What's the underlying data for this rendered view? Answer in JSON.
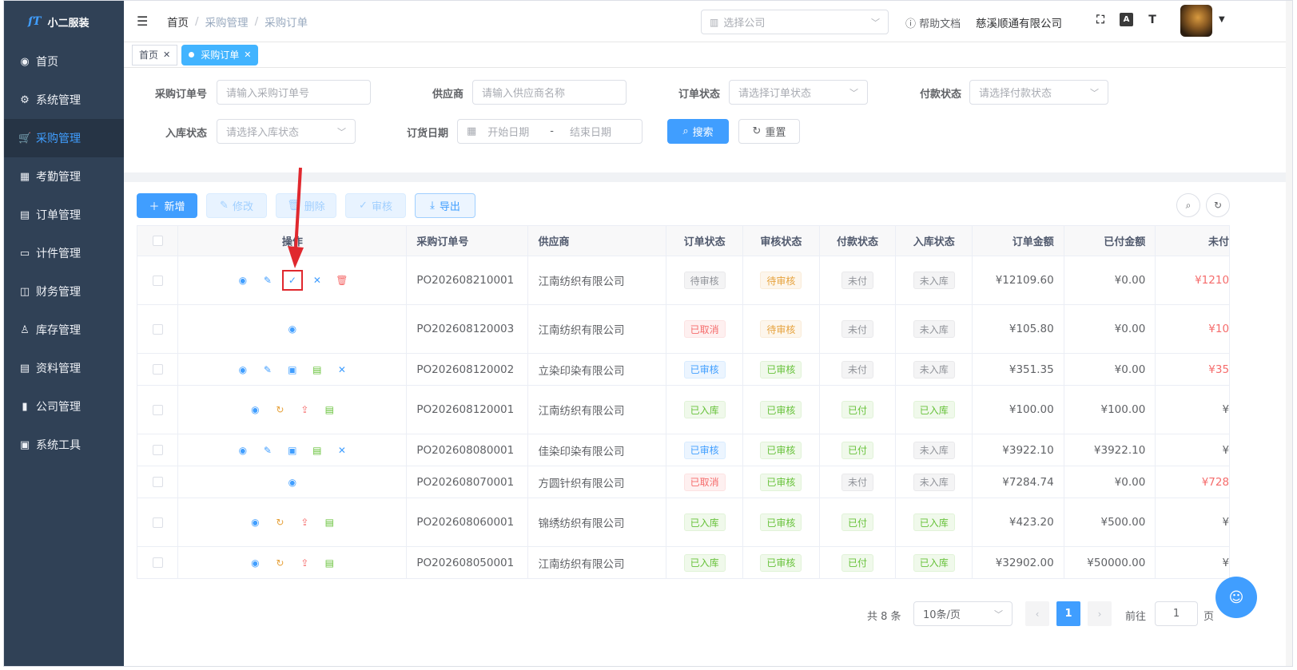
{
  "sidebar": {
    "logo_mark": "ſƬ",
    "logo_text": "小二服装",
    "items": [
      {
        "label": "首页",
        "icon": "dashboard-icon",
        "glyph": "◉"
      },
      {
        "label": "系统管理",
        "icon": "gear-icon",
        "glyph": "⚙"
      },
      {
        "label": "采购管理",
        "icon": "cart-icon",
        "glyph": "🛒"
      },
      {
        "label": "考勤管理",
        "icon": "grid-icon",
        "glyph": "▦"
      },
      {
        "label": "订单管理",
        "icon": "order-icon",
        "glyph": "▤"
      },
      {
        "label": "计件管理",
        "icon": "book-icon",
        "glyph": "▭"
      },
      {
        "label": "财务管理",
        "icon": "chart-monitor-icon",
        "glyph": "◫"
      },
      {
        "label": "库存管理",
        "icon": "user-icon",
        "glyph": "♙"
      },
      {
        "label": "资料管理",
        "icon": "document-icon",
        "glyph": "▤"
      },
      {
        "label": "公司管理",
        "icon": "bar-chart-icon",
        "glyph": "▮"
      },
      {
        "label": "系统工具",
        "icon": "toolbox-icon",
        "glyph": "▣"
      }
    ]
  },
  "header": {
    "breadcrumb": [
      "首页",
      "采购管理",
      "采购订单"
    ],
    "company_placeholder": "选择公司",
    "help": "帮助文档",
    "company_name": "慈溪顺通有限公司"
  },
  "tags": [
    {
      "label": "首页"
    },
    {
      "label": "采购订单"
    }
  ],
  "search": {
    "po_label": "采购订单号",
    "po_placeholder": "请输入采购订单号",
    "supplier_label": "供应商",
    "supplier_placeholder": "请输入供应商名称",
    "order_status_label": "订单状态",
    "order_status_placeholder": "请选择订单状态",
    "pay_status_label": "付款状态",
    "pay_status_placeholder": "请选择付款状态",
    "stock_status_label": "入库状态",
    "stock_status_placeholder": "请选择入库状态",
    "date_label": "订货日期",
    "date_start": "开始日期",
    "date_sep": "-",
    "date_end": "结束日期",
    "search_btn": "搜索",
    "reset_btn": "重置"
  },
  "toolbar": {
    "add": "新增",
    "edit": "修改",
    "delete": "删除",
    "audit": "审核",
    "export": "导出"
  },
  "table": {
    "headers": [
      "操作",
      "采购订单号",
      "供应商",
      "订单状态",
      "审核状态",
      "付款状态",
      "入库状态",
      "订单金额",
      "已付金额",
      "未付"
    ],
    "rows": [
      {
        "h": 61,
        "ops": [
          [
            "eye-icon",
            "◉",
            "blue"
          ],
          [
            "edit-icon",
            "✎",
            "blue"
          ],
          [
            "check-icon",
            "✓",
            "blue"
          ],
          [
            "close-icon",
            "✕",
            "blue"
          ],
          [
            "delete-icon",
            "🗑",
            "red"
          ]
        ],
        "highlight": 2,
        "po": "PO202608210001",
        "supplier": "江南纺织有限公司",
        "order": [
          "待审核",
          "gray"
        ],
        "audit": [
          "待审核",
          "orange"
        ],
        "pay": [
          "未付",
          "gray"
        ],
        "stock": [
          "未入库",
          "gray"
        ],
        "amount": "¥12109.60",
        "paid": "¥0.00",
        "unpaid": "¥1210",
        "unpaid_red": true
      },
      {
        "h": 61,
        "ops": [
          [
            "eye-icon",
            "◉",
            "blue"
          ]
        ],
        "po": "PO202608120003",
        "supplier": "江南纺织有限公司",
        "order": [
          "已取消",
          "red"
        ],
        "audit": [
          "待审核",
          "orange"
        ],
        "pay": [
          "未付",
          "gray"
        ],
        "stock": [
          "未入库",
          "gray"
        ],
        "amount": "¥105.80",
        "paid": "¥0.00",
        "unpaid": "¥10",
        "unpaid_red": true
      },
      {
        "h": 40,
        "ops": [
          [
            "eye-icon",
            "◉",
            "blue"
          ],
          [
            "edit-icon",
            "✎",
            "blue"
          ],
          [
            "stock-in-icon",
            "▣",
            "blue"
          ],
          [
            "payment-icon",
            "▤",
            "green"
          ],
          [
            "close-icon",
            "✕",
            "blue"
          ]
        ],
        "po": "PO202608120002",
        "supplier": "立染印染有限公司",
        "order": [
          "已审核",
          "blue"
        ],
        "audit": [
          "已审核",
          "green"
        ],
        "pay": [
          "未付",
          "gray"
        ],
        "stock": [
          "未入库",
          "gray"
        ],
        "amount": "¥351.35",
        "paid": "¥0.00",
        "unpaid": "¥35",
        "unpaid_red": true
      },
      {
        "h": 61,
        "ops": [
          [
            "eye-icon",
            "◉",
            "blue"
          ],
          [
            "refresh-icon",
            "↻",
            "orange"
          ],
          [
            "return-icon",
            "⇪",
            "red"
          ],
          [
            "payment-icon",
            "▤",
            "green"
          ]
        ],
        "po": "PO202608120001",
        "supplier": "江南纺织有限公司",
        "order": [
          "已入库",
          "green"
        ],
        "audit": [
          "已审核",
          "green"
        ],
        "pay": [
          "已付",
          "green"
        ],
        "stock": [
          "已入库",
          "green"
        ],
        "amount": "¥100.00",
        "paid": "¥100.00",
        "unpaid": "¥",
        "unpaid_red": false
      },
      {
        "h": 40,
        "ops": [
          [
            "eye-icon",
            "◉",
            "blue"
          ],
          [
            "edit-icon",
            "✎",
            "blue"
          ],
          [
            "stock-in-icon",
            "▣",
            "blue"
          ],
          [
            "payment-icon",
            "▤",
            "green"
          ],
          [
            "close-icon",
            "✕",
            "blue"
          ]
        ],
        "po": "PO202608080001",
        "supplier": "佳染印染有限公司",
        "order": [
          "已审核",
          "blue"
        ],
        "audit": [
          "已审核",
          "green"
        ],
        "pay": [
          "已付",
          "green"
        ],
        "stock": [
          "未入库",
          "gray"
        ],
        "amount": "¥3922.10",
        "paid": "¥3922.10",
        "unpaid": "¥",
        "unpaid_red": false
      },
      {
        "h": 40,
        "ops": [
          [
            "eye-icon",
            "◉",
            "blue"
          ]
        ],
        "po": "PO202608070001",
        "supplier": "方圆针织有限公司",
        "order": [
          "已取消",
          "red"
        ],
        "audit": [
          "已审核",
          "green"
        ],
        "pay": [
          "未付",
          "gray"
        ],
        "stock": [
          "未入库",
          "gray"
        ],
        "amount": "¥7284.74",
        "paid": "¥0.00",
        "unpaid": "¥728",
        "unpaid_red": true
      },
      {
        "h": 61,
        "ops": [
          [
            "eye-icon",
            "◉",
            "blue"
          ],
          [
            "refresh-icon",
            "↻",
            "orange"
          ],
          [
            "return-icon",
            "⇪",
            "red"
          ],
          [
            "payment-icon",
            "▤",
            "green"
          ]
        ],
        "po": "PO202608060001",
        "supplier": "锦绣纺织有限公司",
        "order": [
          "已入库",
          "green"
        ],
        "audit": [
          "已审核",
          "green"
        ],
        "pay": [
          "已付",
          "green"
        ],
        "stock": [
          "已入库",
          "green"
        ],
        "amount": "¥423.20",
        "paid": "¥500.00",
        "unpaid": "¥",
        "unpaid_red": false
      },
      {
        "h": 40,
        "ops": [
          [
            "eye-icon",
            "◉",
            "blue"
          ],
          [
            "refresh-icon",
            "↻",
            "orange"
          ],
          [
            "return-icon",
            "⇪",
            "red"
          ],
          [
            "payment-icon",
            "▤",
            "green"
          ]
        ],
        "po": "PO202608050001",
        "supplier": "江南纺织有限公司",
        "order": [
          "已入库",
          "green"
        ],
        "audit": [
          "已审核",
          "green"
        ],
        "pay": [
          "已付",
          "green"
        ],
        "stock": [
          "已入库",
          "green"
        ],
        "amount": "¥32902.00",
        "paid": "¥50000.00",
        "unpaid": "¥",
        "unpaid_red": false
      }
    ]
  },
  "pagination": {
    "total": "共 8 条",
    "page_size": "10条/页",
    "current": "1",
    "goto_label": "前往",
    "goto_value": "1",
    "page_unit": "页"
  },
  "colors": {
    "accent": "#409eff",
    "sidebar_bg": "#304156",
    "annotation_red": "#e0282e"
  }
}
